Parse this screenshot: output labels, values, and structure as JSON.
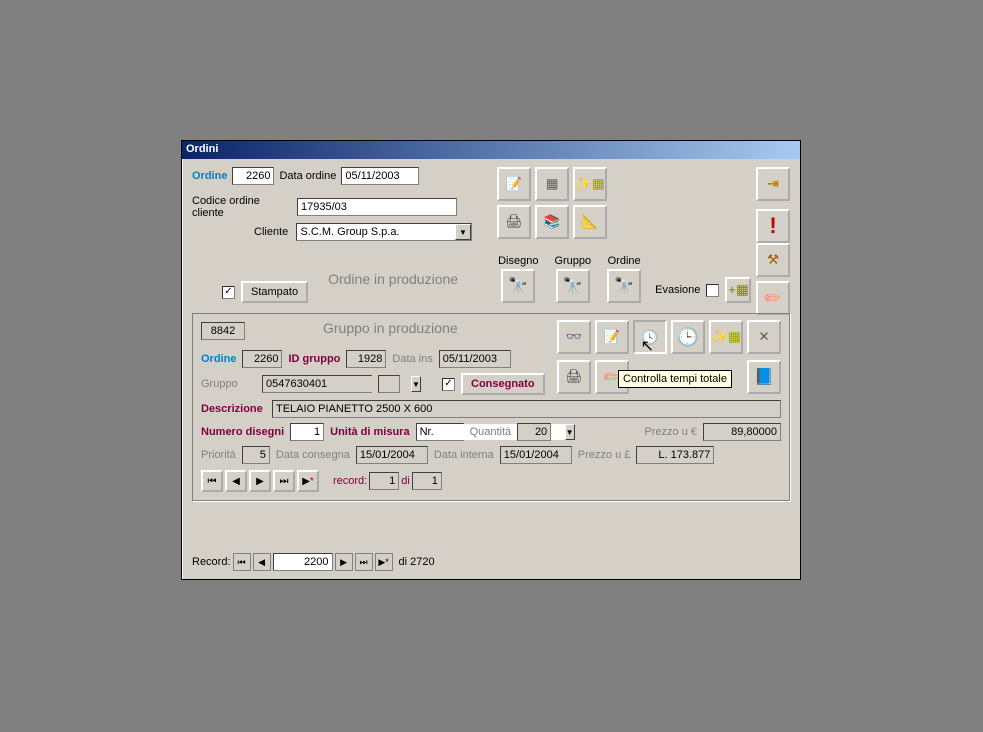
{
  "window": {
    "title": "Ordini"
  },
  "top": {
    "ordine_label": "Ordine",
    "ordine_value": "2260",
    "data_ordine_label": "Data ordine",
    "data_ordine_value": "05/11/2003",
    "codice_label": "Codice ordine cliente",
    "codice_value": "17935/03",
    "cliente_label": "Cliente",
    "cliente_value": "S.C.M. Group S.p.a."
  },
  "mid": {
    "stampato_checked": true,
    "stampato_label": "Stampato",
    "heading": "Ordine in produzione",
    "col1": "Disegno",
    "col2": "Gruppo",
    "col3": "Ordine",
    "evasione_label": "Evasione"
  },
  "panel": {
    "id_value": "8842",
    "heading": "Gruppo in produzione",
    "ordine_label": "Ordine",
    "ordine_value": "2260",
    "id_gruppo_label": "ID gruppo",
    "id_gruppo_value": "1928",
    "data_ins_label": "Data ins",
    "data_ins_value": "05/11/2003",
    "gruppo_label": "Gruppo",
    "gruppo_value": "0547630401",
    "consegnato_checked": true,
    "consegnato_label": "Consegnato",
    "descrizione_label": "Descrizione",
    "descrizione_value": "TELAIO PIANETTO 2500 X 600",
    "num_disegni_label": "Numero disegni",
    "num_disegni_value": "1",
    "unita_label": "Unità di misura",
    "unita_value": "Nr.",
    "quantita_label": "Quantità",
    "quantita_value": "20",
    "prezzo_u_eur_label": "Prezzo u €",
    "prezzo_u_eur_value": "89,80000",
    "priorita_label": "Priorità",
    "priorita_value": "5",
    "data_consegna_label": "Data consegna",
    "data_consegna_value": "15/01/2004",
    "data_interna_label": "Data interna",
    "data_interna_value": "15/01/2004",
    "prezzo_u_lire_label": "Prezzo u £",
    "prezzo_u_lire_value": "L. 173.877",
    "record_label": "record:",
    "record_cur": "1",
    "record_di": "di",
    "record_tot": "1",
    "tooltip": "Controlla tempi totale"
  },
  "status": {
    "label": "Record:",
    "current": "2200",
    "di": "di 2720"
  }
}
